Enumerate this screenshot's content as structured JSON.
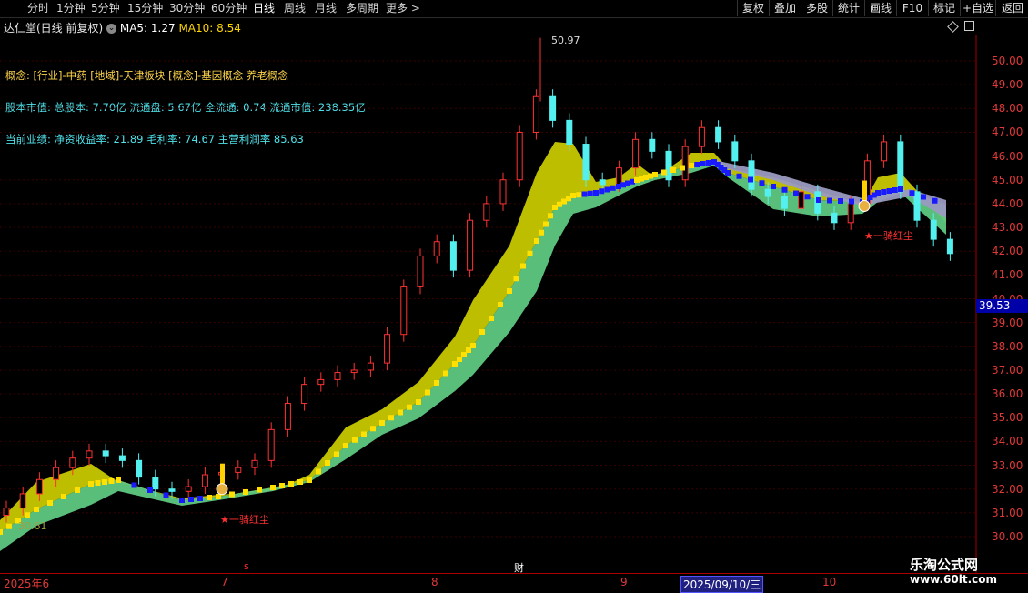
{
  "toolbar": {
    "periods": [
      "分时",
      "1分钟",
      "5分钟",
      "15分钟",
      "30分钟",
      "60分钟",
      "日线",
      "周线",
      "月线",
      "多周期",
      "更多 >"
    ],
    "active": "日线",
    "right": [
      "复权",
      "叠加",
      "多股",
      "统计",
      "画线",
      "F10",
      "标记",
      "+自选",
      "返回"
    ]
  },
  "header": {
    "title": "达仁堂(日线 前复权)",
    "ma5_label": "MA5: 1.27",
    "ma10_label": "MA10: 8.54"
  },
  "info": {
    "concepts": "概念: [行业]-中药 [地域]-天津板块 [概念]-基因概念 养老概念",
    "capital": "股本市值: 总股本: 7.70亿 流通盘: 5.67亿 全流通: 0.74 流通市值: 238.35亿",
    "performance": "当前业绩: 净资收益率: 21.89 毛利率: 74.67 主营利润率 85.63"
  },
  "chart": {
    "peak_label": "50.97",
    "y_ticks": [
      "50.00",
      "49.00",
      "48.00",
      "47.00",
      "46.00",
      "45.00",
      "44.00",
      "43.00",
      "42.00",
      "41.00",
      "40.00",
      "39.00",
      "38.00",
      "37.00",
      "36.00",
      "35.00",
      "34.00",
      "33.00",
      "32.00",
      "31.00",
      "30.00"
    ],
    "current_price": "39.53",
    "signal_label": "★一骑红尘",
    "signal_label2": "★一骑红尘",
    "low_label": "30.61",
    "colors": {
      "up": "#ff3232",
      "down": "#54f0f0",
      "yellow": "#c8c800",
      "green": "#5fc882",
      "accent_blue": "#0000cc"
    }
  },
  "xaxis": {
    "labels": [
      "2025年6",
      "7",
      "8",
      "9",
      "10"
    ],
    "marker_s": "s",
    "marker_cai": "财",
    "cursor_date": "2025/09/10/三"
  },
  "watermark": {
    "line1": "乐淘公式网",
    "line2": "www.60lt.com"
  }
}
